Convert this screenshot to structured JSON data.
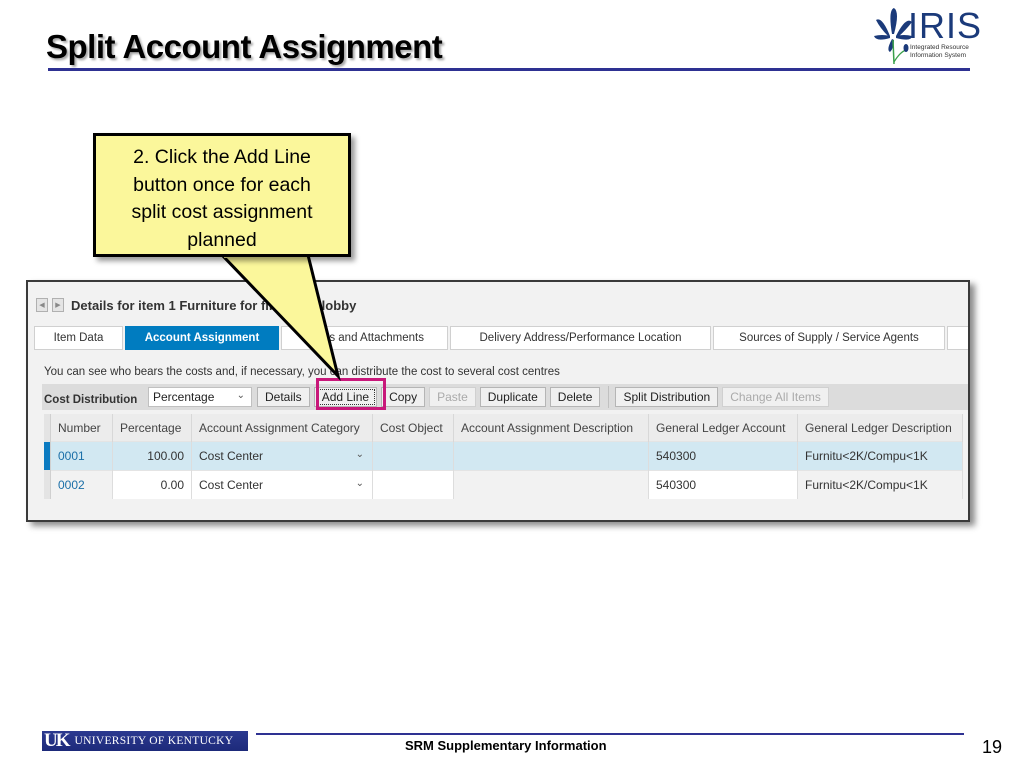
{
  "slide": {
    "title": "Split Account Assignment",
    "logo": {
      "name": "IRIS",
      "subtitle_line1": "Integrated Resource",
      "subtitle_line2": "Information System"
    }
  },
  "callout": {
    "text_lines": [
      "2. Click the Add Line",
      "button once for each",
      "split cost assignment",
      "planned"
    ]
  },
  "sap": {
    "header_title": "Details for item 1  Furniture for first floor lobby",
    "tabs": [
      {
        "label": "Item Data",
        "active": false
      },
      {
        "label": "Account Assignment",
        "active": true
      },
      {
        "label": "Notes and Attachments",
        "active": false
      },
      {
        "label": "Delivery Address/Performance Location",
        "active": false
      },
      {
        "label": "Sources of Supply / Service Agents",
        "active": false
      }
    ],
    "info_text": "You can see who bears the costs and, if necessary, you can distribute the cost to several cost centres",
    "toolbar": {
      "cost_distribution_label": "Cost Distribution",
      "cost_distribution_value": "Percentage",
      "buttons": [
        {
          "label": "Details",
          "enabled": true
        },
        {
          "label": "Add Line",
          "enabled": true
        },
        {
          "label": "Copy",
          "enabled": true
        },
        {
          "label": "Paste",
          "enabled": false
        },
        {
          "label": "Duplicate",
          "enabled": true
        },
        {
          "label": "Delete",
          "enabled": true
        }
      ],
      "buttons_right": [
        {
          "label": "Split Distribution",
          "enabled": true
        },
        {
          "label": "Change All Items",
          "enabled": false
        }
      ]
    },
    "table": {
      "columns": [
        "Number",
        "Percentage",
        "Account Assignment Category",
        "Cost Object",
        "Account Assignment Description",
        "General Ledger Account",
        "General Ledger Description"
      ],
      "rows": [
        {
          "number": "0001",
          "percentage": "100.00",
          "category": "Cost Center",
          "cost_object": "",
          "description": "",
          "gl_account": "540300",
          "gl_description": "Furnitu<2K/Compu<1K",
          "selected": true
        },
        {
          "number": "0002",
          "percentage": "0.00",
          "category": "Cost Center",
          "cost_object": "",
          "description": "",
          "gl_account": "540300",
          "gl_description": "Furnitu<2K/Compu<1K",
          "selected": false
        }
      ]
    }
  },
  "footer": {
    "university": "UNIVERSITY OF KENTUCKY",
    "university_mark": "UK",
    "center_text": "SRM Supplementary Information",
    "page_number": "19"
  }
}
